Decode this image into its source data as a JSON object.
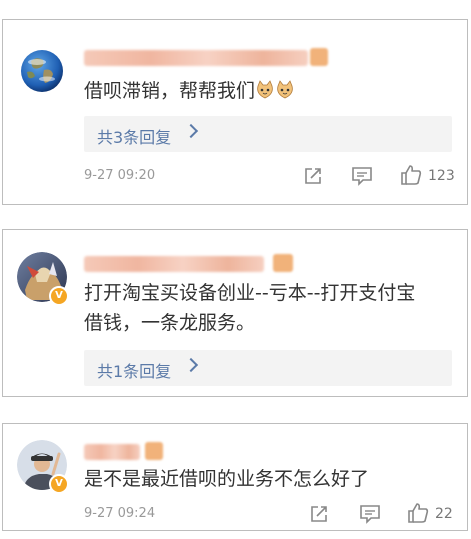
{
  "comments": [
    {
      "text": "借呗滞销，帮帮我们",
      "emoji_icons": [
        "cat-face-icon",
        "cat-face-icon"
      ],
      "replies_label": "共3条回复",
      "time": "9-27 09:20",
      "likes": "123",
      "avatar": "earth-avatar"
    },
    {
      "text_line1": "打开淘宝买设备创业--亏本--打开支付宝",
      "text_line2": "借钱，一条龙服务。",
      "replies_label": "共1条回复",
      "avatar": "game-character-avatar",
      "verified": true
    },
    {
      "text": "是不是最近借呗的业务不怎么好了",
      "time": "9-27 09:24",
      "likes": "22",
      "avatar": "person-avatar",
      "verified": true
    }
  ],
  "colors": {
    "link": "#5b7aa8",
    "muted": "#999999",
    "text": "#333333",
    "badge": "#f5a623"
  }
}
